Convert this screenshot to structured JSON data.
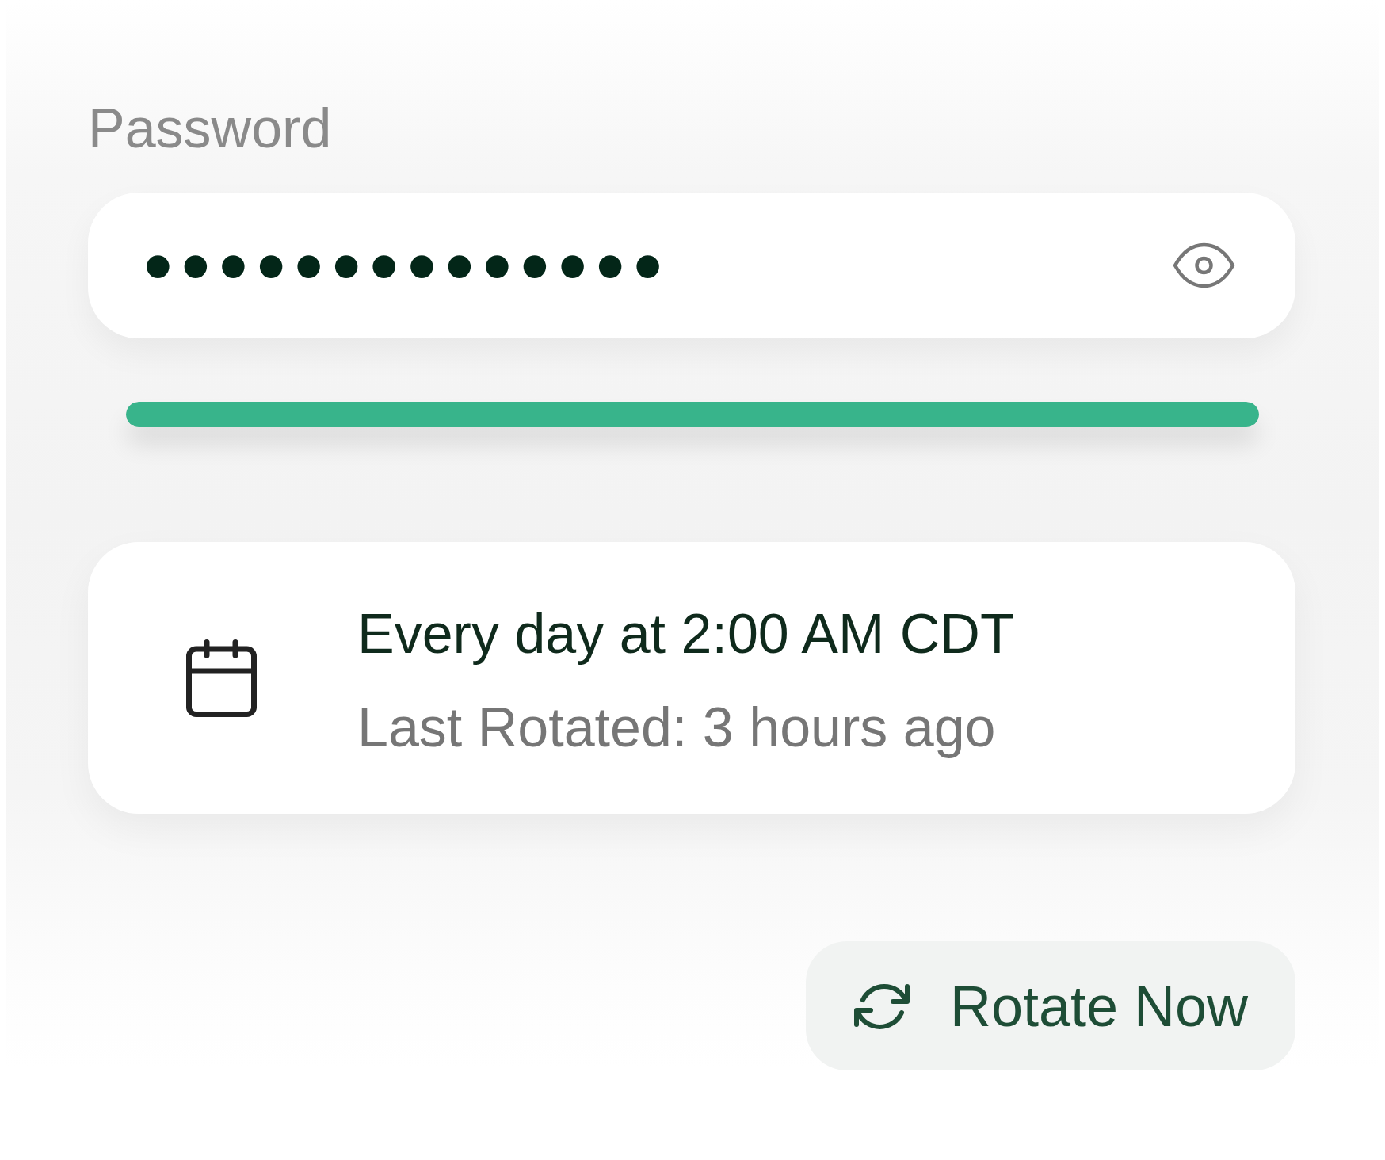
{
  "password_field": {
    "label": "Password",
    "value": "••••••••••••••"
  },
  "strength_meter": {
    "level": 1
  },
  "schedule": {
    "title": "Every day at 2:00 AM CDT",
    "last_rotated": "Last Rotated: 3 hours ago"
  },
  "rotate_button": {
    "label": "Rotate Now"
  }
}
